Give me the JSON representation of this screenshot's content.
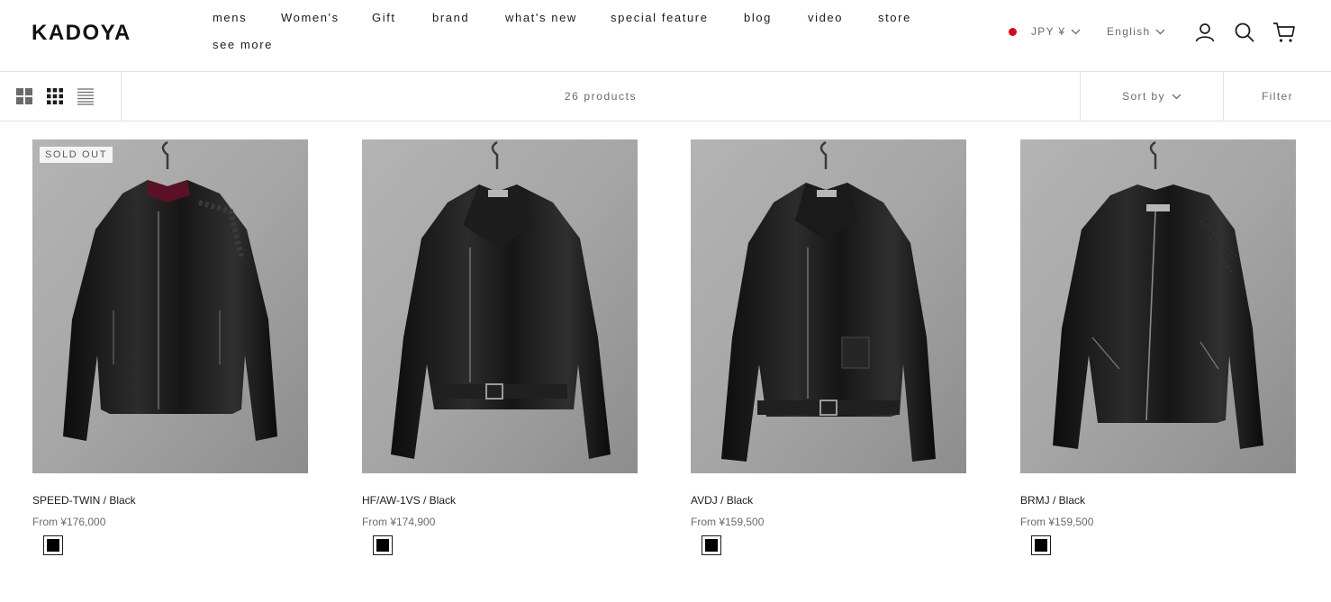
{
  "brand": {
    "logo_text": "KADOYA"
  },
  "nav": {
    "items": [
      "mens",
      "Women's",
      "Gift",
      "brand",
      "what's new",
      "special feature",
      "blog",
      "video",
      "store"
    ],
    "more": "see more"
  },
  "locale": {
    "currency": "JPY ¥",
    "language": "English"
  },
  "header_icons": [
    "account-icon",
    "search-icon",
    "cart-icon"
  ],
  "toolbar": {
    "product_count": "26 products",
    "sort_label": "Sort by",
    "filter_label": "Filter"
  },
  "products": [
    {
      "title": "SPEED-TWIN / Black",
      "price": "From ¥176,000",
      "badge": "SOLD OUT",
      "swatch_color": "#000000"
    },
    {
      "title": "HF/AW-1VS / Black",
      "price": "From ¥174,900",
      "badge": "",
      "swatch_color": "#000000"
    },
    {
      "title": "AVDJ / Black",
      "price": "From ¥159,500",
      "badge": "",
      "swatch_color": "#000000"
    },
    {
      "title": "BRMJ / Black",
      "price": "From ¥159,500",
      "badge": "",
      "swatch_color": "#000000"
    }
  ],
  "colors": {
    "accent_dot": "#d00f1a",
    "text": "#1c1b1b",
    "muted": "#6a6a6a",
    "border": "#e1e3e4"
  }
}
